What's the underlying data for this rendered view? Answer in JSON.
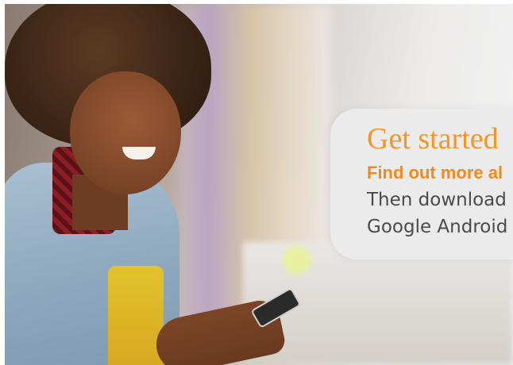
{
  "banner": {
    "title": "Get started",
    "subtitle": "Find out more al",
    "body_line_1": "Then download",
    "body_line_2": "Google Android",
    "colors": {
      "title": "#f2962b",
      "subtitle": "#f08a1c",
      "body": "#4a4a4a",
      "panel": "#ebebeb"
    },
    "photo": "person-smiling-with-phone"
  }
}
